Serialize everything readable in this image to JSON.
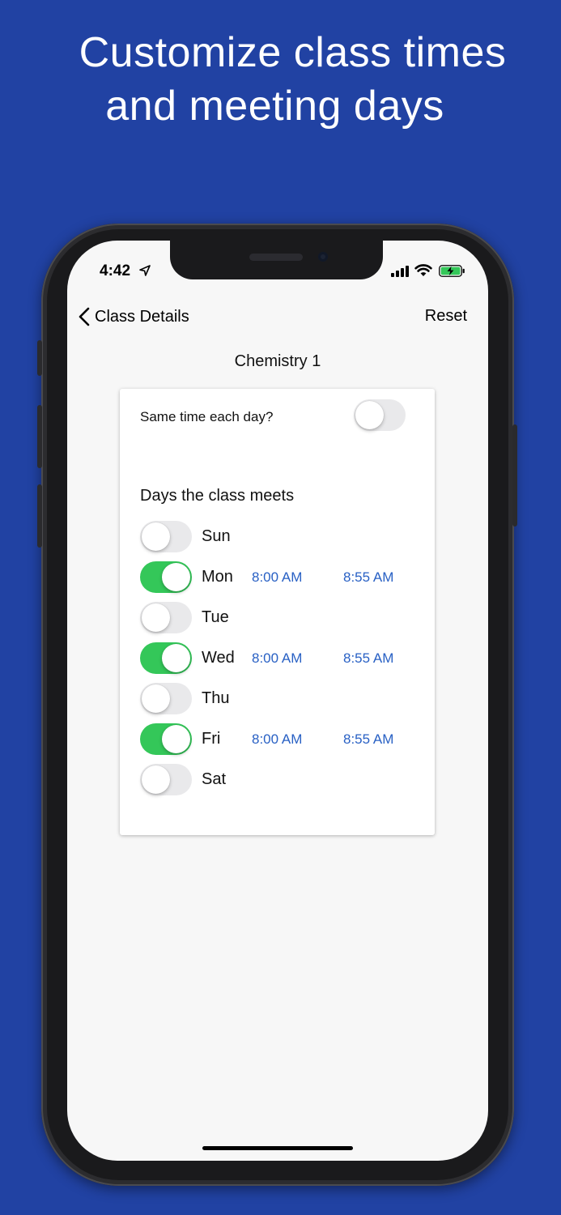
{
  "headline": {
    "line1": "Customize class times",
    "line2": "and meeting days"
  },
  "status_bar": {
    "time": "4:42",
    "icons": [
      "location-arrow-icon",
      "signal-bars-icon",
      "wifi-icon",
      "battery-charging-icon"
    ],
    "battery_color": "#34c759"
  },
  "nav": {
    "back_label": "Class Details",
    "reset_label": "Reset"
  },
  "page": {
    "title": "Chemistry 1"
  },
  "card": {
    "same_time_label": "Same time each day?",
    "same_time_on": false,
    "section_title": "Days the class meets",
    "days": [
      {
        "label": "Sun",
        "on": false,
        "start": "",
        "end": ""
      },
      {
        "label": "Mon",
        "on": true,
        "start": "8:00 AM",
        "end": "8:55 AM"
      },
      {
        "label": "Tue",
        "on": false,
        "start": "",
        "end": ""
      },
      {
        "label": "Wed",
        "on": true,
        "start": "8:00 AM",
        "end": "8:55 AM"
      },
      {
        "label": "Thu",
        "on": false,
        "start": "",
        "end": ""
      },
      {
        "label": "Fri",
        "on": true,
        "start": "8:00 AM",
        "end": "8:55 AM"
      },
      {
        "label": "Sat",
        "on": false,
        "start": "",
        "end": ""
      }
    ]
  },
  "colors": {
    "background": "#2142a3",
    "toggle_on": "#34c759",
    "toggle_off": "#e9e9eb",
    "time_link": "#2860c4"
  }
}
